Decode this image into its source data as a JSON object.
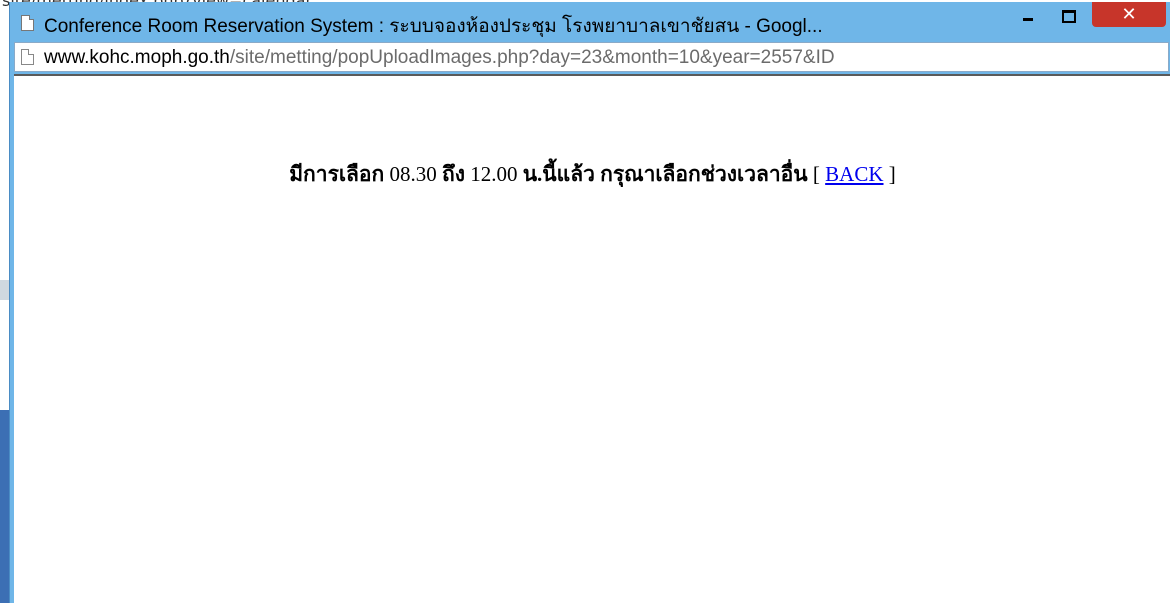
{
  "background": {
    "url_fragment": "site/metting/index.php?view=calendar"
  },
  "window": {
    "title": "Conference Room Reservation System : ระบบจองห้องประชุม โรงพยาบาลเขาชัยสน - Googl...",
    "controls": {
      "minimize": "–",
      "maximize": "□",
      "close": "✕"
    },
    "colors": {
      "frame": "#6fb6e8",
      "close": "#c7352a"
    }
  },
  "address_bar": {
    "host": "www.kohc.moph.go.th",
    "path": "/site/metting/popUploadImages.php?day=23&month=10&year=2557&ID"
  },
  "message": {
    "part1": "มีการเลือก",
    "start_time": "08.30",
    "part2": "ถึง",
    "end_time": "12.00",
    "part3": "น.นี้แล้ว กรุณาเลือกช่วงเวลาอื่น",
    "bracket_open": "[",
    "back_link": "BACK",
    "bracket_close": "]"
  }
}
